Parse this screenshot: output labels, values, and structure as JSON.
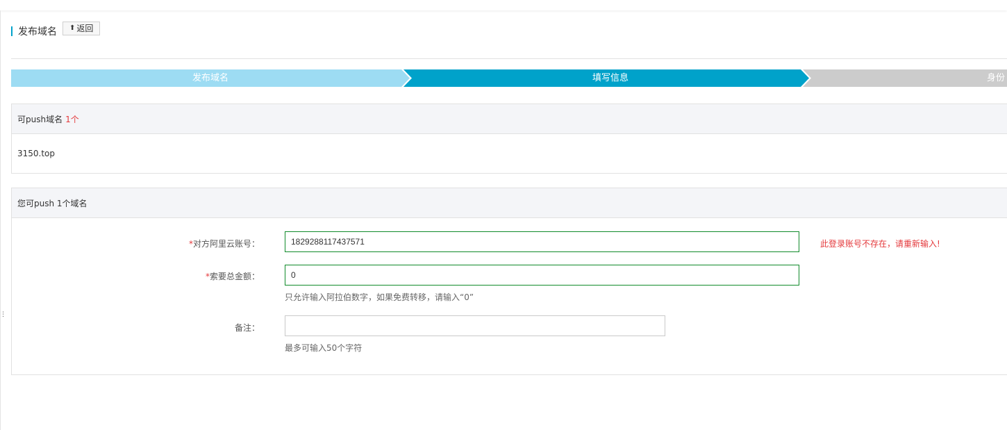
{
  "header": {
    "title": "发布域名",
    "back_label": "返回"
  },
  "steps": [
    {
      "label": "发布域名",
      "state": "done"
    },
    {
      "label": "填写信息",
      "state": "current"
    },
    {
      "label": "身份",
      "state": "pending"
    }
  ],
  "domains_panel": {
    "title": "可push域名",
    "count": "1个",
    "domain": "3150.top"
  },
  "form_panel": {
    "title": "您可push 1个域名",
    "account": {
      "required_mark": "*",
      "label": "对方阿里云账号：",
      "value": "1829288117437571",
      "error": "此登录账号不存在，请重新输入!"
    },
    "amount": {
      "required_mark": "*",
      "label": "索要总金额：",
      "value": "0",
      "hint": "只允许输入阿拉伯数字，如果免费转移，请输入“0”"
    },
    "remark": {
      "label": "备注：",
      "value": "",
      "hint": "最多可输入50个字符"
    }
  },
  "colors": {
    "step_done": "#9ddcf3",
    "step_current": "#00a2ca",
    "step_pending": "#cccccc",
    "error": "#e4393c",
    "valid_border": "#0f8a29"
  }
}
